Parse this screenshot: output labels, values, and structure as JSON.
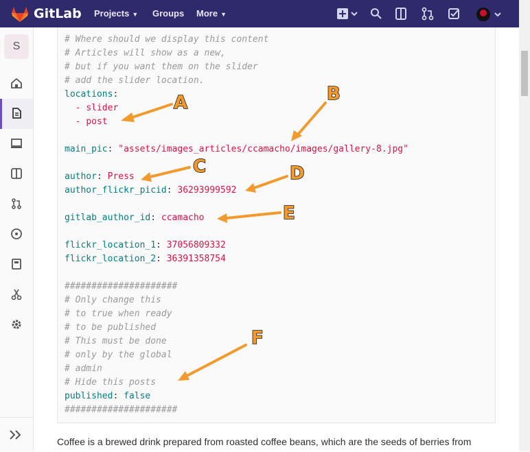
{
  "header": {
    "brand": "GitLab",
    "nav": [
      {
        "label": "Projects"
      },
      {
        "label": "Groups"
      },
      {
        "label": "More"
      }
    ]
  },
  "sidebar": {
    "avatar_letter": "S",
    "items": [
      "home-icon",
      "file-icon",
      "monitor-icon",
      "issues-icon",
      "merge-request-icon",
      "ci-icon",
      "wiki-icon",
      "snippets-icon",
      "settings-icon"
    ],
    "active": "file-icon"
  },
  "code": {
    "c1": "# Where should we display this content",
    "c2": "# Articles will show as a new,",
    "c3": "# but if you want them on the slider",
    "c4": "# add the slider location.",
    "locations_key": "locations",
    "colon": ":",
    "dash": "  - ",
    "loc1": "slider",
    "loc2": "post",
    "main_pic_key": "main_pic",
    "main_pic_val": "\"assets/images_articles/ccamacho/images/gallery-8.jpg\"",
    "author_key": "author",
    "author_val": "Press",
    "author_flickr_key": "author_flickr_picid",
    "author_flickr_val": "36293999592",
    "gitlab_author_key": "gitlab_author_id",
    "gitlab_author_val": "ccamacho",
    "flickr1_key": "flickr_location_1",
    "flickr1_val": "37056809332",
    "flickr2_key": "flickr_location_2",
    "flickr2_val": "36391358754",
    "hash": "#####################",
    "c5": "# Only change this",
    "c6": "# to true when ready",
    "c7": "# to be published",
    "c8": "# This must be done",
    "c9": "# only by the global",
    "c10": "# admin",
    "c11": "# Hide this posts",
    "published_key": "published",
    "published_val": "false"
  },
  "paragraph": "Coffee is a brewed drink prepared from roasted coffee beans, which are the seeds of berries from",
  "annotations": [
    "A",
    "B",
    "C",
    "D",
    "E",
    "F"
  ],
  "colors": {
    "header": "#2f2a6b",
    "arrow": "#f29a2e",
    "key": "#008080",
    "string": "#dd1144",
    "comment": "#999999"
  }
}
